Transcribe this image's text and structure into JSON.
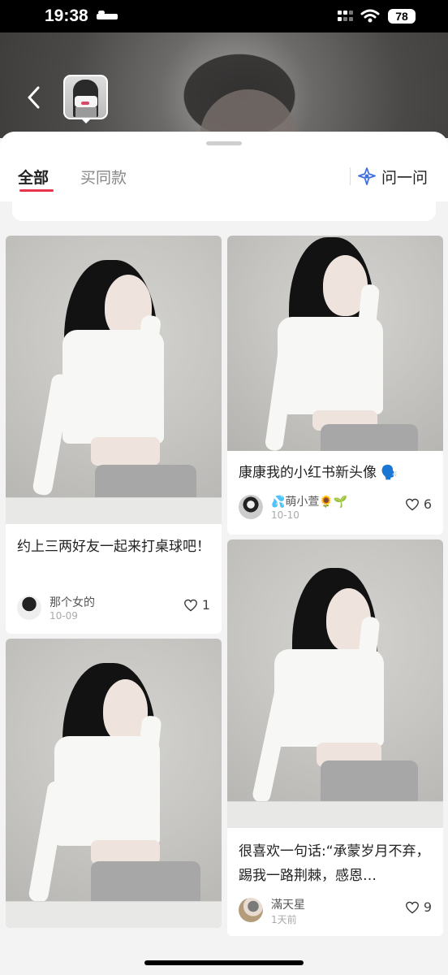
{
  "status_bar": {
    "time": "19:38",
    "battery": "78"
  },
  "tabs": {
    "all": "全部",
    "same_style": "买同款",
    "ask": "问一问"
  },
  "posts": [
    {
      "title": "约上三两好友一起来打桌球吧！",
      "author": "那个女的",
      "date": "10-09",
      "likes": "1"
    },
    {
      "title": "康康我的小红书新头像 🗣️",
      "author": "💦萌小萱🌻🌱",
      "date": "10-10",
      "likes": "6"
    },
    {
      "title": "很喜欢一句话:“承蒙岁月不弃，踢我一路荆棘，感恩…",
      "author": "滿天星",
      "date": "1天前",
      "likes": "9"
    }
  ],
  "icons": {
    "back": "chevron-left-icon",
    "ask": "sparkle-icon",
    "likes": "heart-icon"
  },
  "colors": {
    "accent": "#e8344a"
  }
}
